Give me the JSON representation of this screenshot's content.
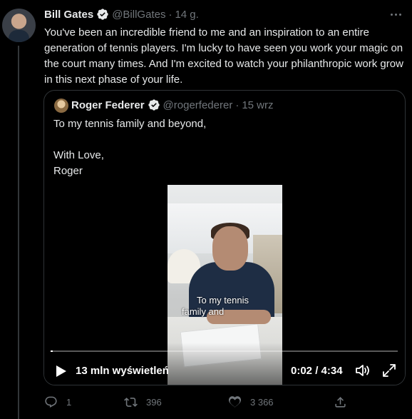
{
  "tweet": {
    "author_name": "Bill Gates",
    "author_handle": "@BillGates",
    "separator": "·",
    "time": "14 g.",
    "text": "You've been an incredible friend to me and an inspiration to an entire generation of tennis players. I'm lucky to have seen you work your magic on the court many times. And I'm excited to watch your philanthropic work grow in this next phase of your life."
  },
  "quote": {
    "author_name": "Roger Federer",
    "author_handle": "@rogerfederer",
    "separator": "·",
    "time": "15 wrz",
    "text_line1": "To my tennis family and beyond,",
    "text_line2": "With Love,",
    "text_line3": "Roger",
    "video": {
      "caption_line1": "To my tennis",
      "caption_line2": "family and",
      "views": "13 mln wyświetleń",
      "timecode": "0:02 / 4:34",
      "progress": 0.007
    }
  },
  "actions": {
    "reply_count": "1",
    "retweet_count": "396",
    "like_count": "3 366"
  },
  "colors": {
    "background": "#000000",
    "text": "#e7e9ea",
    "secondary": "#71767b",
    "border": "#2f3336",
    "verified": "#e7e9ea"
  },
  "icons": [
    "verified-badge-icon",
    "more-icon",
    "play-icon",
    "volume-icon",
    "fullscreen-icon",
    "reply-icon",
    "retweet-icon",
    "like-icon",
    "share-icon"
  ]
}
